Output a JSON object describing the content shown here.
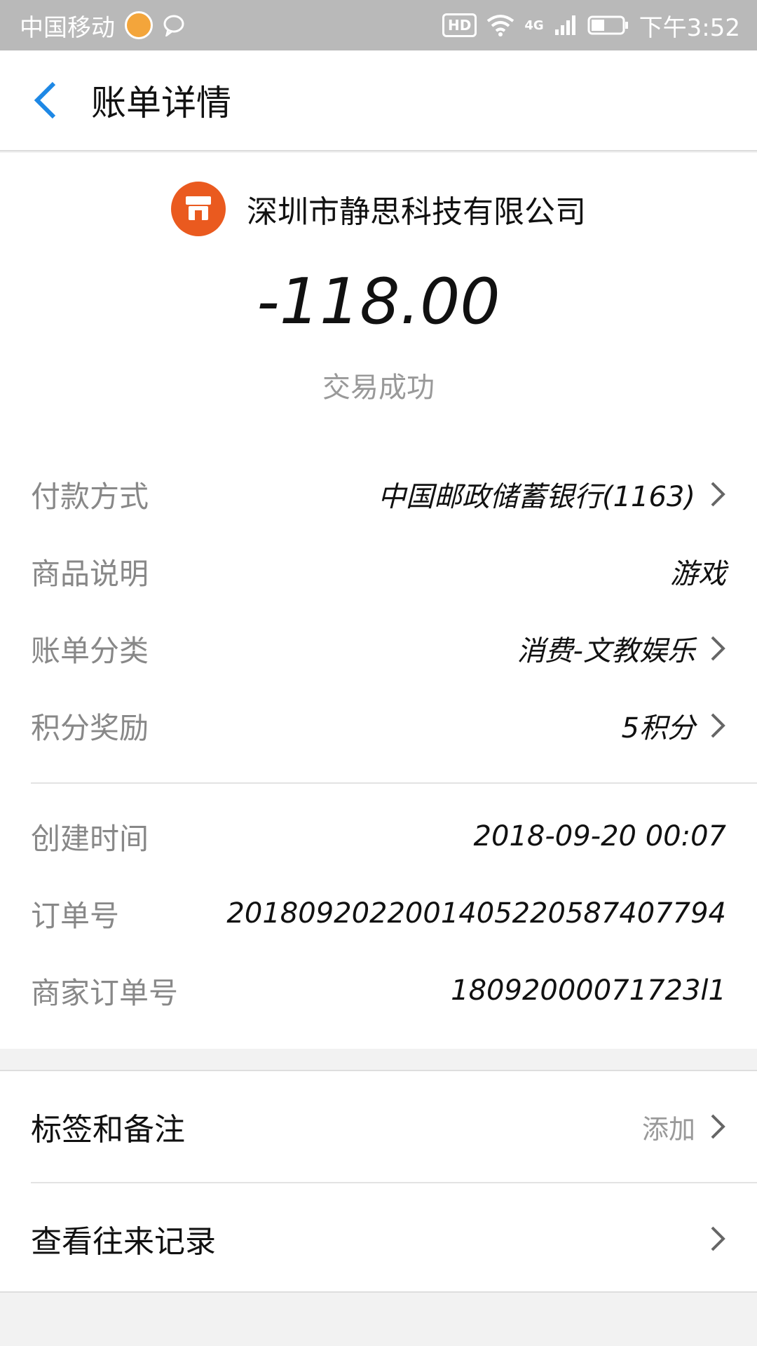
{
  "status_bar": {
    "carrier": "中国移动",
    "network": "4G",
    "hd": "HD",
    "time": "下午3:52"
  },
  "header": {
    "title": "账单详情"
  },
  "bill": {
    "merchant": "深圳市静思科技有限公司",
    "amount": "-118.00",
    "status": "交易成功",
    "details": [
      {
        "label": "付款方式",
        "value": "中国邮政储蓄银行(1163)",
        "has_arrow": true
      },
      {
        "label": "商品说明",
        "value": "游戏",
        "has_arrow": false
      },
      {
        "label": "账单分类",
        "value": "消费-文教娱乐",
        "has_arrow": true
      },
      {
        "label": "积分奖励",
        "value": "5积分",
        "has_arrow": true
      }
    ],
    "meta": [
      {
        "label": "创建时间",
        "value": "2018-09-20 00:07"
      },
      {
        "label": "订单号",
        "value": "2018092022001405220587407794"
      },
      {
        "label": "商家订单号",
        "value": "18092000071723l1"
      }
    ]
  },
  "actions": {
    "tags_label": "标签和备注",
    "tags_action": "添加",
    "history_label": "查看往来记录"
  },
  "colors": {
    "accent": "#1e88e5",
    "merchant_icon": "#ea5a1f"
  },
  "icons": {
    "back": "chevron-left-icon",
    "merchant": "shop-icon",
    "arrow": "chevron-right-icon"
  }
}
